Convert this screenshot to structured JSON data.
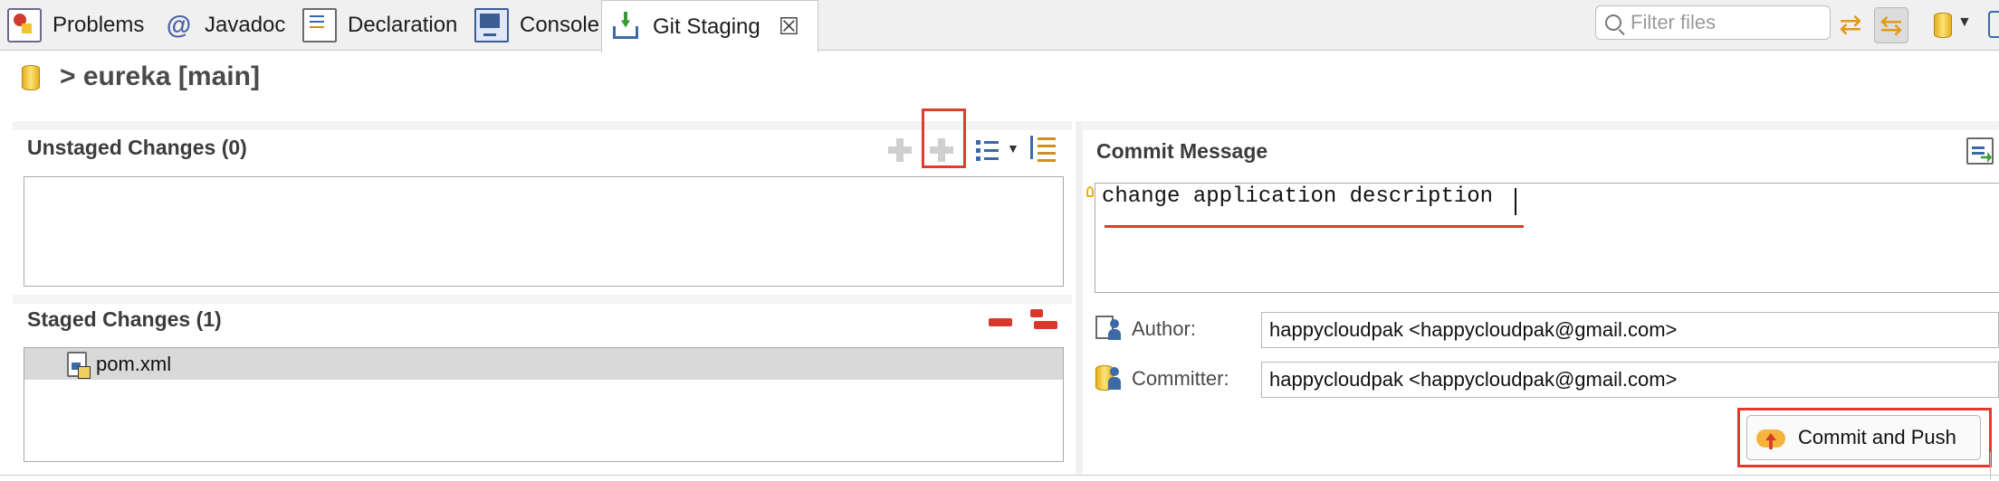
{
  "tabs": [
    {
      "label": "Problems",
      "icon": "problems-icon"
    },
    {
      "label": "Javadoc",
      "icon": "at-icon"
    },
    {
      "label": "Declaration",
      "icon": "declaration-icon"
    },
    {
      "label": "Console",
      "icon": "console-icon"
    },
    {
      "label": "Git Staging",
      "icon": "git-staging-icon",
      "active": true
    }
  ],
  "filter": {
    "placeholder": "Filter files"
  },
  "repo": {
    "title": "> eureka [main]"
  },
  "unstaged": {
    "title": "Unstaged Changes (0)",
    "files": []
  },
  "staged": {
    "title": "Staged Changes (1)",
    "files": [
      {
        "name": "pom.xml"
      }
    ]
  },
  "commit": {
    "title": "Commit Message",
    "message": "change application description",
    "author_label": "Author:",
    "author_value": "happycloudpak <happycloudpak@gmail.com>",
    "committer_label": "Committer:",
    "committer_value": "happycloudpak <happycloudpak@gmail.com>",
    "button_label": "Commit and Push"
  },
  "colors": {
    "highlight": "#e03b2e",
    "accent": "#e8b018"
  }
}
